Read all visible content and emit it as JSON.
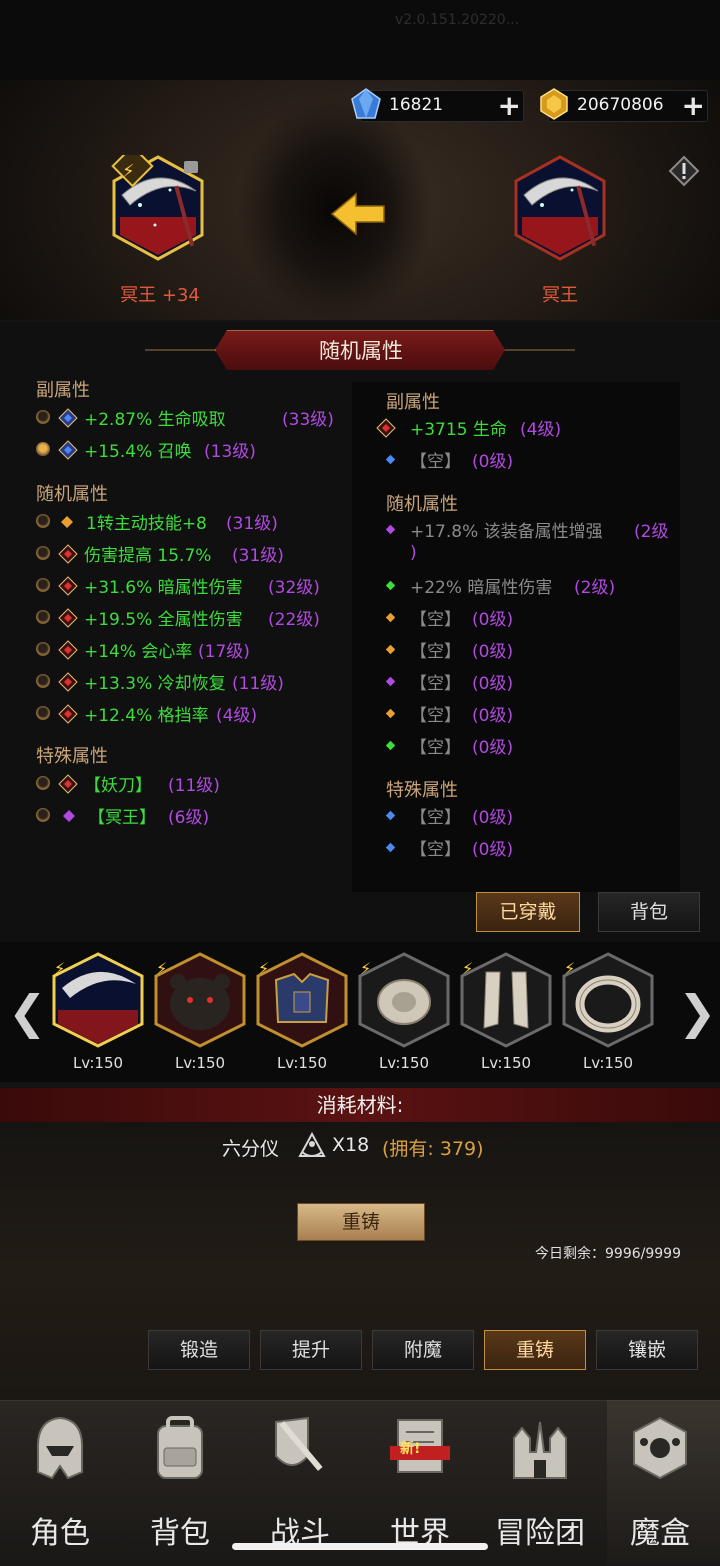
{
  "header": {
    "version_text": "v2.0.151.20220...",
    "diamonds": "16821",
    "gold": "20670806"
  },
  "compare": {
    "left_item_label": "冥王 +34",
    "right_item_label": "冥王"
  },
  "panel": {
    "title": "随机属性",
    "left": {
      "sub_title": "副属性",
      "sub_rows": [
        {
          "text": "+2.87% 生命吸取",
          "level": "(33级)",
          "radio_on": false
        },
        {
          "text": "+15.4% 召唤",
          "level": "(13级)",
          "radio_on": true
        }
      ],
      "random_title": "随机属性",
      "random_rows": [
        {
          "text": "1转主动技能+8",
          "level": "(31级)"
        },
        {
          "text": "伤害提高 15.7%",
          "level": "(31级)"
        },
        {
          "text": "+31.6% 暗属性伤害",
          "level": "(32级)"
        },
        {
          "text": "+19.5% 全属性伤害",
          "level": "(22级)"
        },
        {
          "text": "+14% 会心率",
          "level": "(17级)"
        },
        {
          "text": "+13.3% 冷却恢复",
          "level": "(11级)"
        },
        {
          "text": "+12.4% 格挡率",
          "level": "(4级)"
        }
      ],
      "special_title": "特殊属性",
      "special_rows": [
        {
          "text": "【妖刀】",
          "level": "(11级)"
        },
        {
          "text": "【冥王】",
          "level": "(6级)"
        }
      ]
    },
    "right": {
      "sub_title": "副属性",
      "sub_rows": [
        {
          "text": "+3715 生命",
          "level": "(4级)"
        },
        {
          "text": "【空】",
          "level": "(0级)"
        }
      ],
      "random_title": "随机属性",
      "random_rows": [
        {
          "text": "+17.8% 该装备属性增强",
          "level": "(2级",
          "level2": ")"
        },
        {
          "text": "+22% 暗属性伤害",
          "level": "(2级)"
        },
        {
          "text": "【空】",
          "level": "(0级)"
        },
        {
          "text": "【空】",
          "level": "(0级)"
        },
        {
          "text": "【空】",
          "level": "(0级)"
        },
        {
          "text": "【空】",
          "level": "(0级)"
        },
        {
          "text": "【空】",
          "level": "(0级)"
        }
      ],
      "special_title": "特殊属性",
      "special_rows": [
        {
          "text": "【空】",
          "level": "(0级)"
        },
        {
          "text": "【空】",
          "level": "(0级)"
        }
      ]
    },
    "equipped_button": "已穿戴",
    "bag_button": "背包"
  },
  "equipment_strip": {
    "items": [
      {
        "icon": "scythe-icon",
        "lv": "Lv:150"
      },
      {
        "icon": "bear-head-icon",
        "lv": "Lv:150"
      },
      {
        "icon": "armor-icon",
        "lv": "Lv:150"
      },
      {
        "icon": "belt-icon",
        "lv": "Lv:150"
      },
      {
        "icon": "greaves-icon",
        "lv": "Lv:150"
      },
      {
        "icon": "ring-icon",
        "lv": "Lv:150"
      }
    ]
  },
  "materials": {
    "title": "消耗材料:",
    "name": "六分仪",
    "count": "X18",
    "owned": "(拥有: 379)",
    "action_button": "重铸",
    "remaining": "今日剩余：9996/9999"
  },
  "tabs": [
    "锻造",
    "提升",
    "附魔",
    "重铸",
    "镶嵌"
  ],
  "active_tab": "重铸",
  "nav": {
    "items": [
      "角色",
      "背包",
      "战斗",
      "世界",
      "冒险团",
      "魔盒"
    ],
    "new_badge": "新!"
  },
  "colors": {
    "green": "#3ddc3d",
    "purple": "#b04ae0",
    "gold_section": "#c9a57a",
    "red_label": "#e05a3c"
  }
}
